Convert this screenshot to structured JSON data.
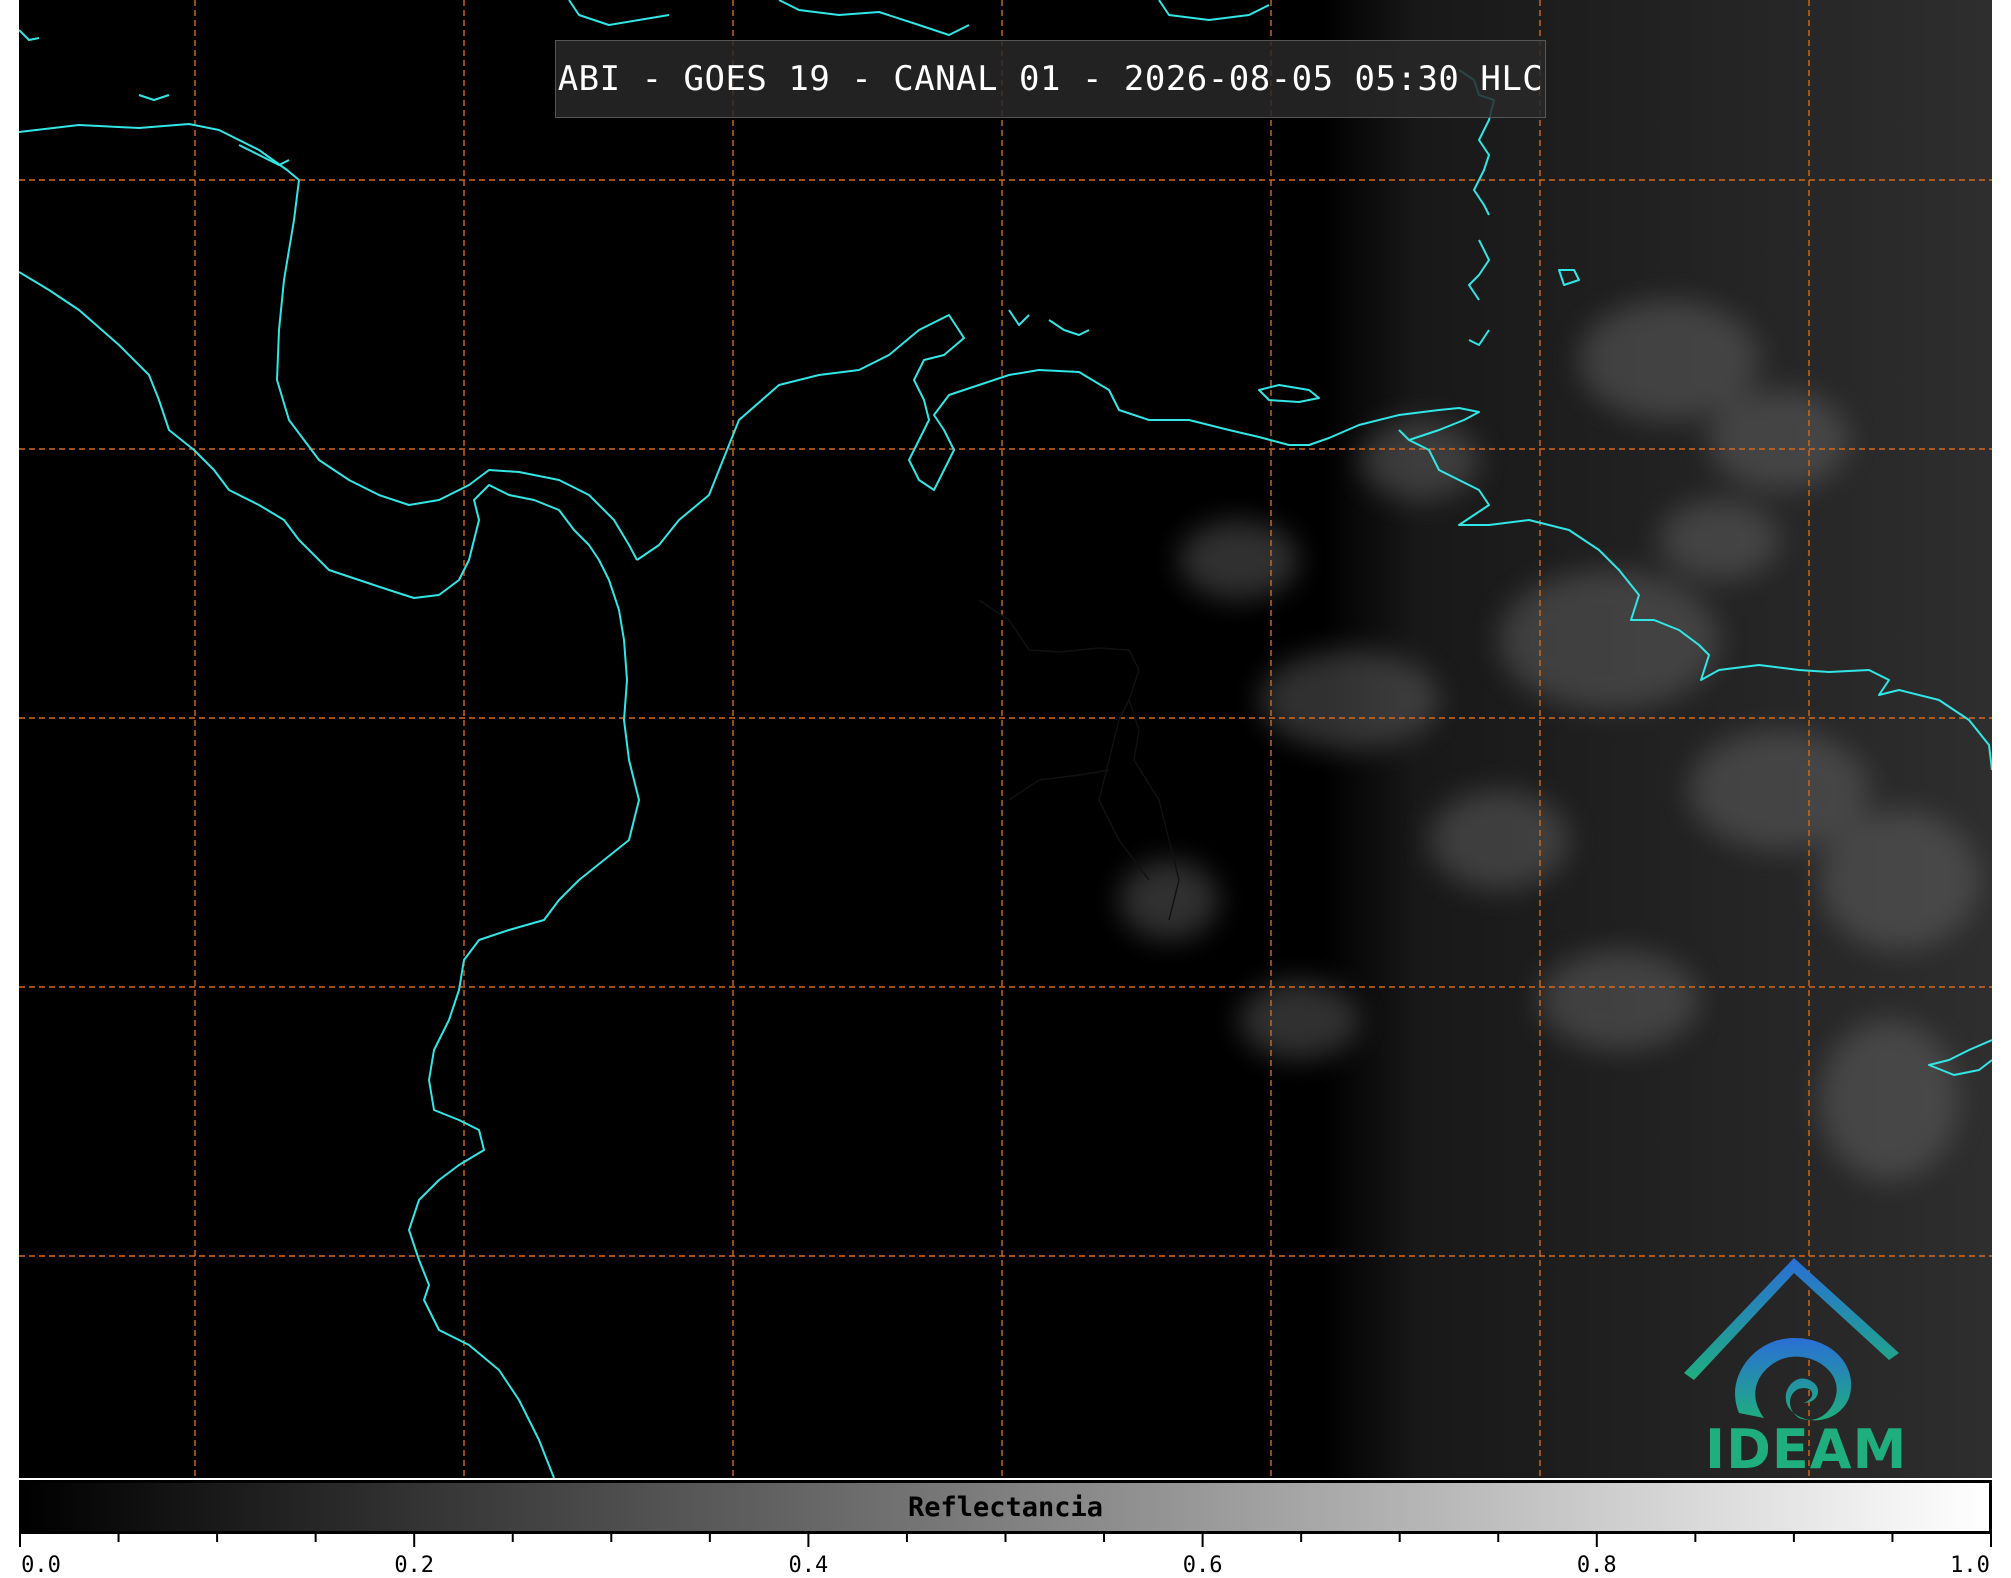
{
  "map": {
    "title": "ABI - GOES 19 - CANAL 01 - 2026-08-05 05:30 HLC",
    "coastline_color": "#33e6e6",
    "grid_color": "#d2691e",
    "logo": {
      "text": "IDEAM",
      "icon": "ideam-logo-icon",
      "color_top": "#2a6fd6",
      "color_bottom": "#1fae7e"
    }
  },
  "colorbar": {
    "label": "Reflectancia",
    "min": 0.0,
    "max": 1.0,
    "ticks": [
      "0.0",
      "0.2",
      "0.4",
      "0.6",
      "0.8",
      "1.0"
    ],
    "tick_values": [
      0.0,
      0.2,
      0.4,
      0.6,
      0.8,
      1.0
    ],
    "minor_step": 0.05,
    "color_low": "#000000",
    "color_high": "#ffffff"
  }
}
